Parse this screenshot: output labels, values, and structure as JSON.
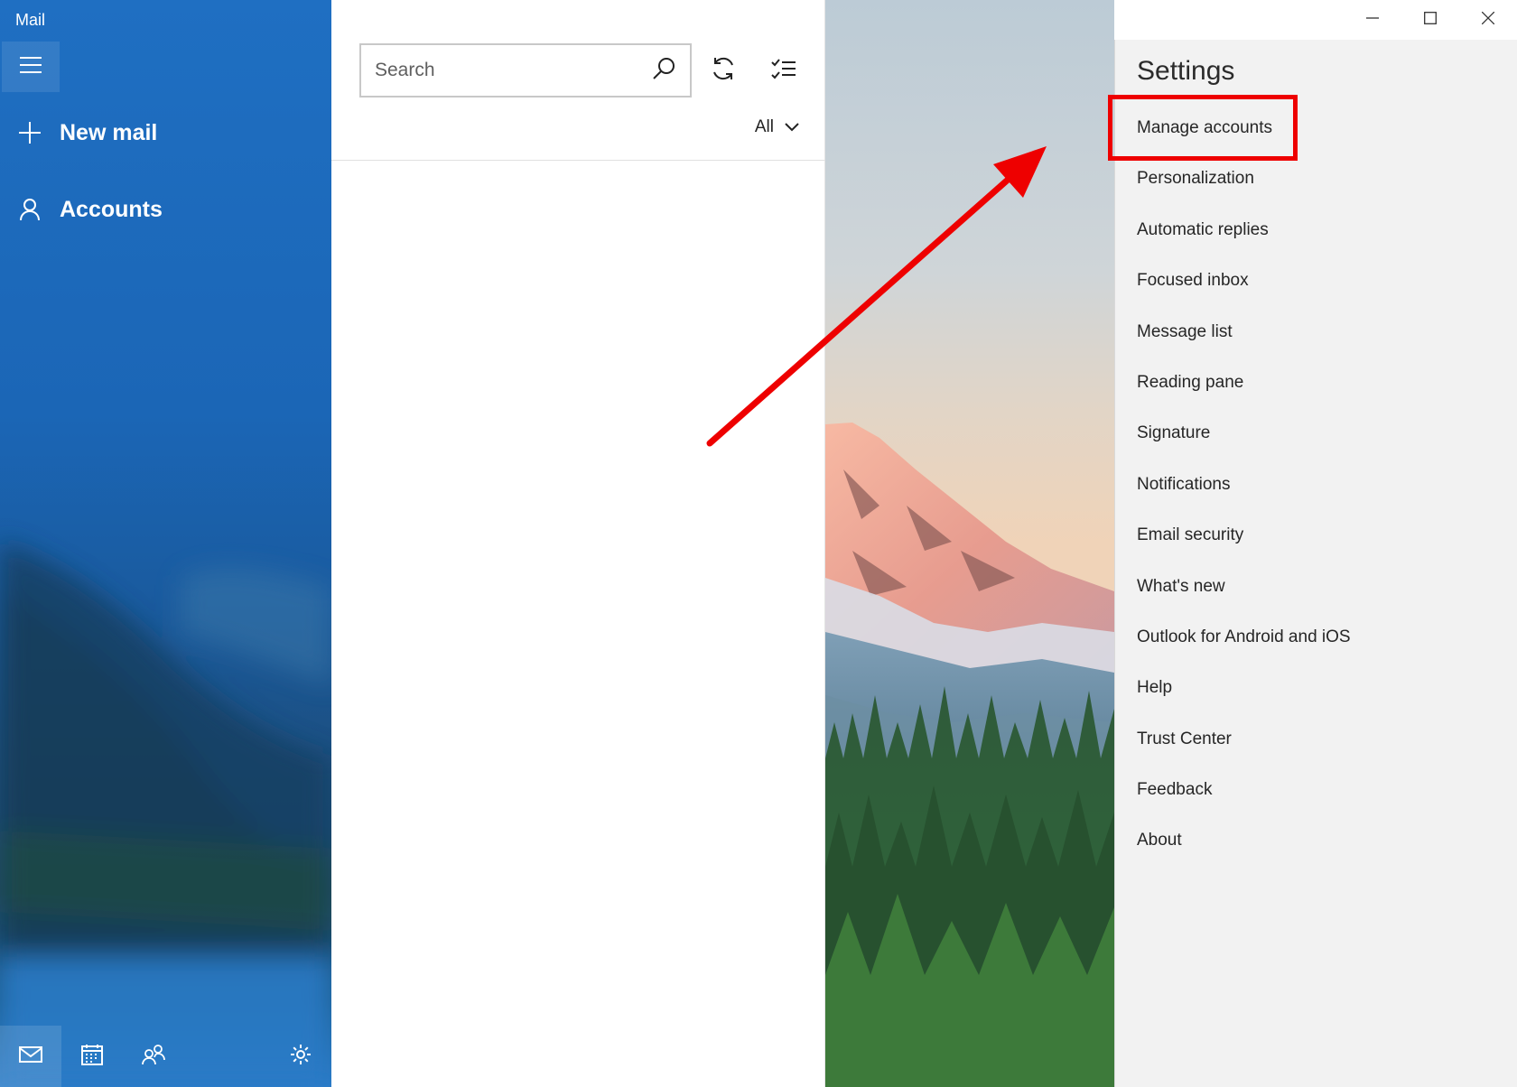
{
  "window": {
    "app_title": "Mail",
    "caption_buttons": [
      "minimize-icon",
      "maximize-icon",
      "close-icon"
    ]
  },
  "nav": {
    "menu_icon": "hamburger-icon",
    "new_mail": {
      "label": "New mail",
      "icon": "plus-icon"
    },
    "accounts": {
      "label": "Accounts",
      "icon": "person-icon"
    },
    "bottom_icons": [
      "mail-icon",
      "calendar-icon",
      "people-icon",
      "gear-icon"
    ]
  },
  "list": {
    "search": {
      "placeholder": "Search",
      "icon": "search-icon"
    },
    "sync_icon": "sync-icon",
    "select_icon": "select-mode-icon",
    "filter": {
      "label": "All",
      "icon": "chevron-down-icon"
    }
  },
  "settings": {
    "title": "Settings",
    "items": [
      "Manage accounts",
      "Personalization",
      "Automatic replies",
      "Focused inbox",
      "Message list",
      "Reading pane",
      "Signature",
      "Notifications",
      "Email security",
      "What's new",
      "Outlook for Android and iOS",
      "Help",
      "Trust Center",
      "Feedback",
      "About"
    ],
    "highlighted_item": "Manage accounts"
  },
  "annotation": {
    "highlight_color": "#ee0000",
    "arrow_color": "#ee0000"
  },
  "colors": {
    "nav_accent": "#1f6fc2",
    "settings_bg": "#f2f2f2"
  }
}
